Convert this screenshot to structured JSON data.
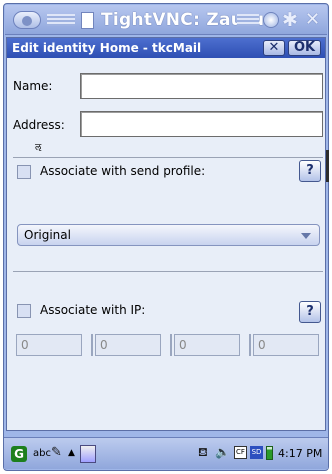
{
  "window": {
    "title": "TightVNC: Zaurus"
  },
  "dialog": {
    "title": "Edit identity Home - tkcMail",
    "close_label": "✕",
    "ok_label": "OK"
  },
  "form": {
    "name_label": "Name:",
    "name_value": "",
    "address_label": "Address:",
    "address_value": "",
    "address_note": "ऌ",
    "send_profile_label": "Associate with send profile:",
    "send_profile_checked": false,
    "help_label": "?",
    "send_profile_selected": "Original",
    "ip_label": "Associate with IP:",
    "ip_checked": false,
    "ip_octets": [
      "0",
      "0",
      "0",
      "0"
    ]
  },
  "taskbar": {
    "launcher_label": "G",
    "input_method": "abc",
    "time": "4:17 PM"
  },
  "colors": {
    "titlebar_blue": "#2e4fb3",
    "dialog_bg": "#e8eef8",
    "frame_blue": "#9fb6e8"
  }
}
